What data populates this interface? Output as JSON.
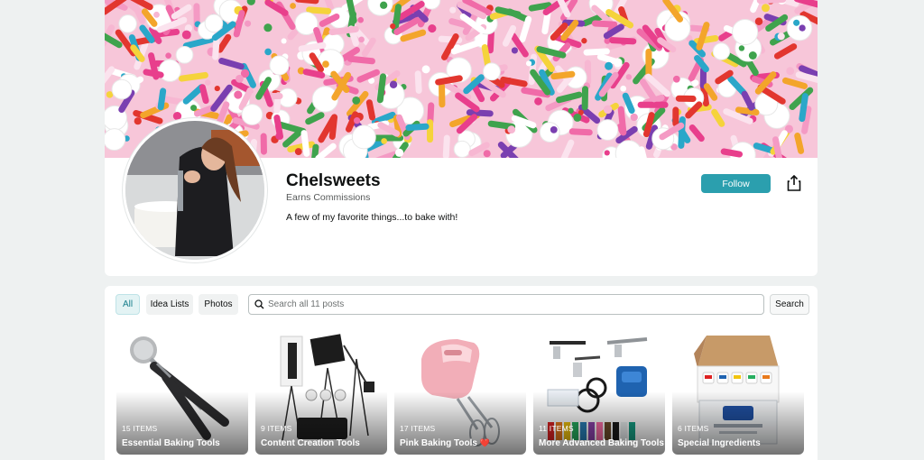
{
  "profile": {
    "name": "Chelsweets",
    "subtitle": "Earns Commissions",
    "bio": "A few of my favorite things...to bake with!",
    "follow_label": "Follow",
    "share_icon": "share-icon"
  },
  "filters": {
    "tabs": [
      {
        "label": "All",
        "active": true
      },
      {
        "label": "Idea Lists",
        "active": false
      },
      {
        "label": "Photos",
        "active": false
      }
    ]
  },
  "search": {
    "placeholder": "Search all 11 posts",
    "button_label": "Search"
  },
  "cards": [
    {
      "count": "15 ITEMS",
      "title": "Essential Baking Tools",
      "emoji": ""
    },
    {
      "count": "9 ITEMS",
      "title": "Content Creation Tools",
      "emoji": ""
    },
    {
      "count": "17 ITEMS",
      "title": "Pink Baking Tools",
      "emoji": "❤️"
    },
    {
      "count": "11 ITEMS",
      "title": "More Advanced Baking Tools",
      "emoji": ""
    },
    {
      "count": "6 ITEMS",
      "title": "Special Ingredients",
      "emoji": ""
    }
  ],
  "colors": {
    "accent": "#2b9fae",
    "page_background": "#eef1f1"
  }
}
